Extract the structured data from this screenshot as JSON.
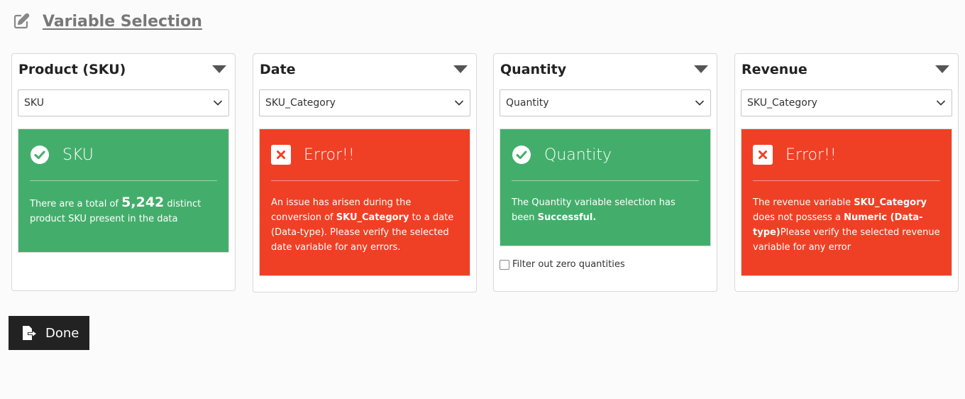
{
  "header": {
    "title": "Variable Selection",
    "icon": "edit-icon"
  },
  "colors": {
    "success": "#43ae6b",
    "error": "#ef4025",
    "button": "#222222"
  },
  "panels": [
    {
      "title": "Product (SKU)",
      "selected": "SKU",
      "status": "success",
      "status_title": "SKU",
      "message": {
        "pre": "There are a total of ",
        "count": "5,242",
        "post": " distinct product SKU present in the data"
      }
    },
    {
      "title": "Date",
      "selected": "SKU_Category",
      "status": "error",
      "status_title": "Error!!",
      "message": {
        "pre": "An issue has arisen during the conversion of ",
        "bold": "SKU_Category",
        "post": " to a date (Data-type). Please verify the selected date variable for any errors."
      }
    },
    {
      "title": "Quantity",
      "selected": "Quantity",
      "status": "success",
      "status_title": "Quantity",
      "message": {
        "pre": "The Quantity variable selection has been ",
        "bold": "Successful."
      },
      "checkbox_label": "Filter out zero quantities",
      "checkbox_checked": false
    },
    {
      "title": "Revenue",
      "selected": "SKU_Category",
      "status": "error",
      "status_title": "Error!!",
      "message": {
        "pre": "The revenue variable ",
        "bold": "SKU_Category",
        "mid": " does not possess a ",
        "bold2": "Numeric (Data-type)",
        "post": "Please verify the selected revenue variable for any error"
      }
    }
  ],
  "done_button": {
    "label": "Done",
    "icon": "export-icon"
  }
}
